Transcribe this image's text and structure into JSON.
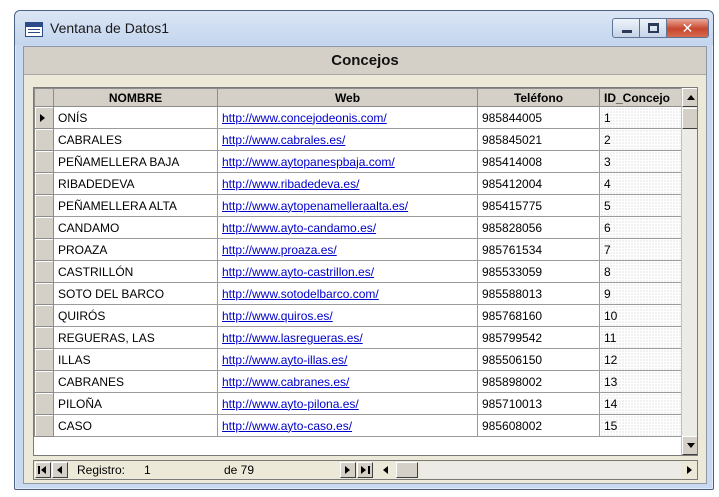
{
  "window": {
    "title": "Ventana de Datos1",
    "icon": "datasheet-icon",
    "controls": {
      "minimize_icon": "minimize-icon",
      "maximize_icon": "maximize-icon",
      "close_icon": "close-icon",
      "close_glyph": "✕"
    }
  },
  "form": {
    "title": "Concejos"
  },
  "grid": {
    "columns": [
      "NOMBRE",
      "Web",
      "Teléfono",
      "ID_Concejo"
    ],
    "current_row_index": 0,
    "rows": [
      {
        "nombre": "ONÍS",
        "web": "http://www.concejodeonis.com/",
        "telefono": "985844005",
        "id": "1"
      },
      {
        "nombre": "CABRALES",
        "web": "http://www.cabrales.es/",
        "telefono": "985845021",
        "id": "2"
      },
      {
        "nombre": "PEÑAMELLERA BAJA",
        "web": "http://www.aytopanespbaja.com/",
        "telefono": "985414008",
        "id": "3"
      },
      {
        "nombre": "RIBADEDEVA",
        "web": "http://www.ribadedeva.es/",
        "telefono": "985412004",
        "id": "4"
      },
      {
        "nombre": "PEÑAMELLERA ALTA",
        "web": "http://www.aytopenamelleraalta.es/",
        "telefono": "985415775",
        "id": "5"
      },
      {
        "nombre": "CANDAMO",
        "web": "http://www.ayto-candamo.es/",
        "telefono": "985828056",
        "id": "6"
      },
      {
        "nombre": "PROAZA",
        "web": "http://www.proaza.es/",
        "telefono": "985761534",
        "id": "7"
      },
      {
        "nombre": "CASTRILLÓN",
        "web": "http://www.ayto-castrillon.es/",
        "telefono": "985533059",
        "id": "8"
      },
      {
        "nombre": "SOTO DEL BARCO",
        "web": "http://www.sotodelbarco.com/",
        "telefono": "985588013",
        "id": "9"
      },
      {
        "nombre": "QUIRÓS",
        "web": "http://www.quiros.es/",
        "telefono": "985768160",
        "id": "10"
      },
      {
        "nombre": "REGUERAS, LAS",
        "web": "http://www.lasregueras.es/",
        "telefono": "985799542",
        "id": "11"
      },
      {
        "nombre": "ILLAS",
        "web": "http://www.ayto-illas.es/",
        "telefono": "985506150",
        "id": "12"
      },
      {
        "nombre": "CABRANES",
        "web": "http://www.cabranes.es/",
        "telefono": "985898002",
        "id": "13"
      },
      {
        "nombre": "PILOÑA",
        "web": "http://www.ayto-pilona.es/",
        "telefono": "985710013",
        "id": "14"
      },
      {
        "nombre": "CASO",
        "web": "http://www.ayto-caso.es/",
        "telefono": "985608002",
        "id": "15"
      }
    ]
  },
  "navigation": {
    "record_label": "Registro:",
    "current_record": "1",
    "total_label": "de 79"
  }
}
